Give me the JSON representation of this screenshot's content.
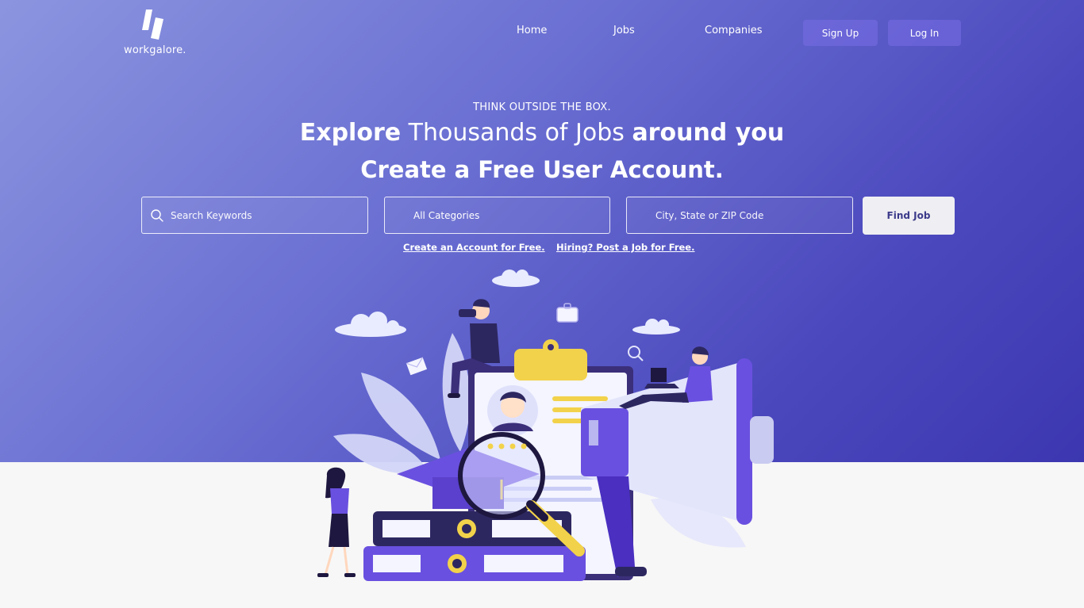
{
  "brand": {
    "name": "workgalore."
  },
  "nav": {
    "links": [
      "Home",
      "Jobs",
      "Companies"
    ],
    "sign_up": "Sign Up",
    "log_in": "Log In"
  },
  "hero": {
    "eyebrow": "THINK OUTSIDE THE BOX.",
    "headline": {
      "part1": "Explore",
      "part2": " Thousands of Jobs ",
      "part3": "around you"
    },
    "subheadline": "Create a Free User Account."
  },
  "search": {
    "keywords_placeholder": "Search Keywords",
    "category_value": "All Categories",
    "location_placeholder": "City, State or ZIP Code",
    "button": "Find Job",
    "icon": "search-icon"
  },
  "links": {
    "create_account": "Create an Account for Free.",
    "post_job": "Hiring? Post a Job for Free."
  },
  "colors": {
    "hero_start": "#8b95df",
    "hero_end": "#3c37b0",
    "accent_yellow": "#f2d24a",
    "accent_purple": "#6a50e0"
  }
}
